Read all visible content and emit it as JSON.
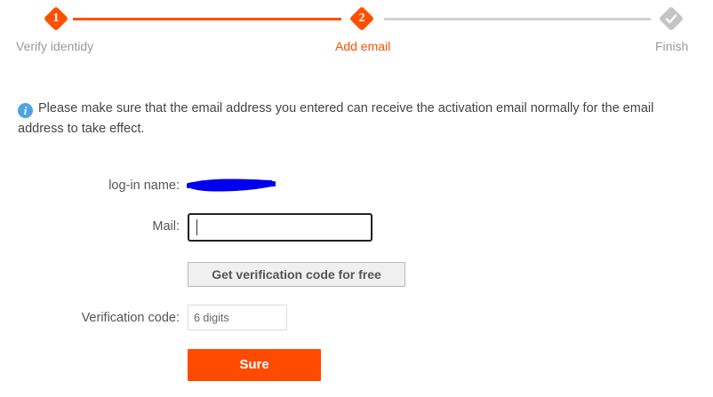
{
  "steps": [
    {
      "number": "1",
      "label": "Verify identidy",
      "state": "done"
    },
    {
      "number": "2",
      "label": "Add email",
      "state": "active"
    },
    {
      "number": "",
      "label": "Finish",
      "state": "todo",
      "icon": "check-icon"
    }
  ],
  "notice": {
    "icon": "info-icon",
    "text": "Please make sure that the email address you entered can receive the activation email normally for the email address to take effect."
  },
  "form": {
    "login_label": "log-in name:",
    "mail_label": "Mail:",
    "mail_value": "",
    "get_code_label": "Get verification code for free",
    "code_label": "Verification code:",
    "code_placeholder": "6 digits",
    "submit_label": "Sure"
  },
  "colors": {
    "accent": "#ff5000",
    "inactive": "#c4c4c4",
    "info": "#4fa3e0",
    "redaction": "#0000ee"
  }
}
